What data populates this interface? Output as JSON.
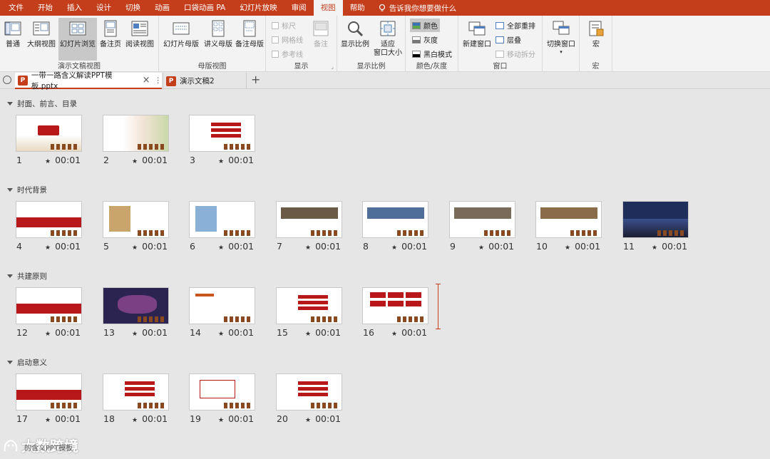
{
  "menu": {
    "tabs": [
      "文件",
      "开始",
      "插入",
      "设计",
      "切换",
      "动画",
      "口袋动画 PA",
      "幻灯片放映",
      "审阅",
      "视图",
      "帮助"
    ],
    "active": "视图",
    "tell_me": "告诉我你想要做什么"
  },
  "ribbon": {
    "presentation_views": {
      "label": "演示文稿视图",
      "normal": "普通",
      "outline": "大纲视图",
      "sorter": "幻灯片浏览",
      "notes": "备注页",
      "reading": "阅读视图"
    },
    "master_views": {
      "label": "母版视图",
      "slide_master": "幻灯片母版",
      "handout_master": "讲义母版",
      "notes_master": "备注母版"
    },
    "show": {
      "label": "显示",
      "ruler": "标尺",
      "gridlines": "网格线",
      "guides": "参考线",
      "notes": "备注"
    },
    "zoom": {
      "label": "显示比例",
      "zoom": "显示比例",
      "fit": "适应\n窗口大小"
    },
    "color": {
      "label": "颜色/灰度",
      "color": "颜色",
      "grayscale": "灰度",
      "bw": "黑白模式"
    },
    "window": {
      "label": "窗口",
      "new_window": "新建窗口",
      "arrange_all": "全部重排",
      "cascade": "层叠",
      "move_split": "移动拆分"
    },
    "switch": {
      "switch_windows": "切换窗口"
    },
    "macros": {
      "label": "宏",
      "macros": "宏"
    }
  },
  "doc_tabs": [
    {
      "name": "一带一路含义解读PPT模板.pptx",
      "close": "×",
      "more": "⋮"
    },
    {
      "name": "演示文稿2"
    }
  ],
  "new_tab": "+",
  "sections": [
    {
      "title": "封面、前言、目录",
      "slides": [
        {
          "n": "1",
          "t": "00:01"
        },
        {
          "n": "2",
          "t": "00:01"
        },
        {
          "n": "3",
          "t": "00:01"
        }
      ]
    },
    {
      "title": "时代背景",
      "slides": [
        {
          "n": "4",
          "t": "00:01"
        },
        {
          "n": "5",
          "t": "00:01"
        },
        {
          "n": "6",
          "t": "00:01"
        },
        {
          "n": "7",
          "t": "00:01"
        },
        {
          "n": "8",
          "t": "00:01"
        },
        {
          "n": "9",
          "t": "00:01"
        },
        {
          "n": "10",
          "t": "00:01"
        },
        {
          "n": "11",
          "t": "00:01"
        }
      ]
    },
    {
      "title": "共建原则",
      "slides": [
        {
          "n": "12",
          "t": "00:01"
        },
        {
          "n": "13",
          "t": "00:01"
        },
        {
          "n": "14",
          "t": "00:01"
        },
        {
          "n": "15",
          "t": "00:01"
        },
        {
          "n": "16",
          "t": "00:01"
        }
      ]
    },
    {
      "title": "启动意义",
      "slides": [
        {
          "n": "17",
          "t": "00:01"
        },
        {
          "n": "18",
          "t": "00:01"
        },
        {
          "n": "19",
          "t": "00:01"
        },
        {
          "n": "20",
          "t": "00:01"
        }
      ]
    }
  ],
  "star": "★",
  "watermark": "大数跨境",
  "watermark_sub": "的含义PPT模板",
  "colors": {
    "accent": "#c43e1c",
    "slide_red": "#b8181a"
  }
}
